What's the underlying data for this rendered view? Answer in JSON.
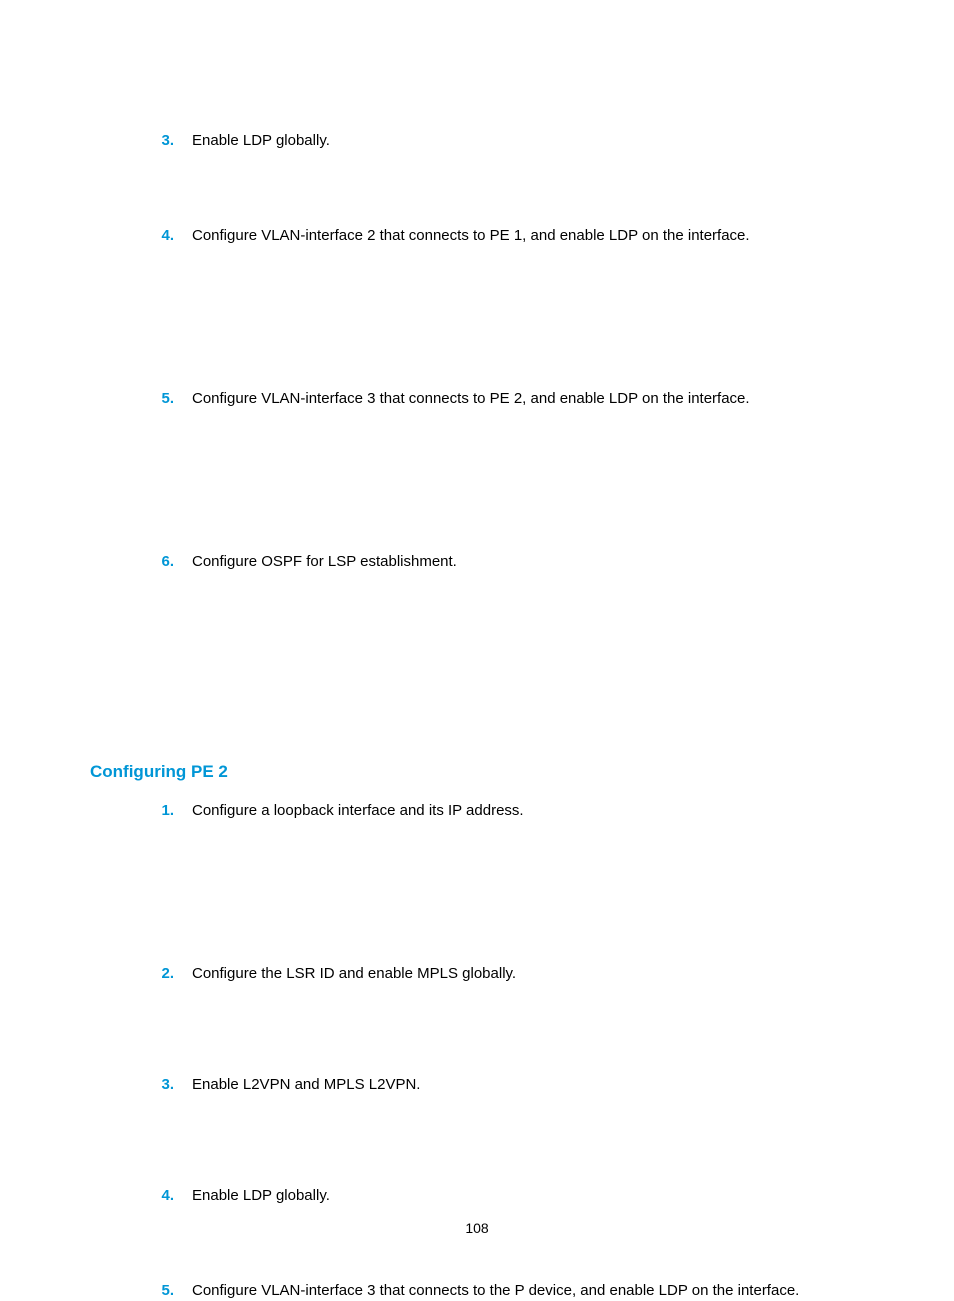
{
  "listA": {
    "items": [
      {
        "num": "3.",
        "text": "Enable LDP globally."
      },
      {
        "num": "4.",
        "text": "Configure VLAN-interface 2 that connects to PE 1, and enable LDP on the interface."
      },
      {
        "num": "5.",
        "text": "Configure VLAN-interface 3 that connects to PE 2, and enable LDP on the interface."
      },
      {
        "num": "6.",
        "text": "Configure OSPF for LSP establishment."
      }
    ]
  },
  "heading": "Configuring PE 2",
  "listB": {
    "items": [
      {
        "num": "1.",
        "text": "Configure a loopback interface and its IP address."
      },
      {
        "num": "2.",
        "text": "Configure the LSR ID and enable MPLS globally."
      },
      {
        "num": "3.",
        "text": "Enable L2VPN and MPLS L2VPN."
      },
      {
        "num": "4.",
        "text": "Enable LDP globally."
      },
      {
        "num": "5.",
        "text": "Configure VLAN-interface 3 that connects to the P device, and enable LDP on the interface."
      }
    ]
  },
  "pageNumber": "108"
}
